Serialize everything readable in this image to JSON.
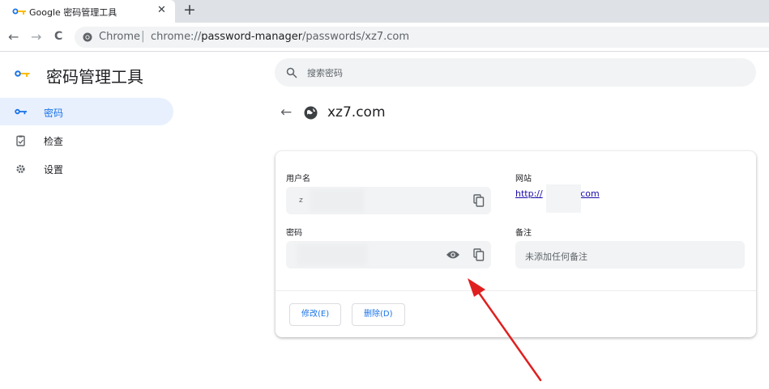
{
  "browser": {
    "tab_title": "Google 密码管理工具",
    "tab_close": "✕",
    "new_tab": "+",
    "back": "←",
    "forward": "→",
    "reload": "C",
    "omnibox_label": "Chrome",
    "omnibox_separator": "|",
    "url_prefix": "chrome://",
    "url_host": "password-manager",
    "url_path": "/passwords/xz7.com"
  },
  "sidebar": {
    "title": "密码管理工具",
    "items": [
      {
        "label": "密码",
        "icon": "key-icon",
        "active": true
      },
      {
        "label": "检查",
        "icon": "clipboard-check-icon",
        "active": false
      },
      {
        "label": "设置",
        "icon": "gear-icon",
        "active": false
      }
    ]
  },
  "search": {
    "placeholder": "搜索密码"
  },
  "detail": {
    "back": "←",
    "site": "xz7.com",
    "username_label": "用户名",
    "username_value": "z",
    "website_label": "网站",
    "website_link_start": "http://",
    "website_link_end": ".com",
    "password_label": "密码",
    "notes_label": "备注",
    "notes_placeholder": "未添加任何备注",
    "edit_button": "修改(E)",
    "delete_button": "删除(D)"
  },
  "colors": {
    "accent": "#1a73e8",
    "nav_active_bg": "#e8f0fe",
    "annotation_arrow": "#e02020",
    "field_bg": "#f1f3f4"
  }
}
